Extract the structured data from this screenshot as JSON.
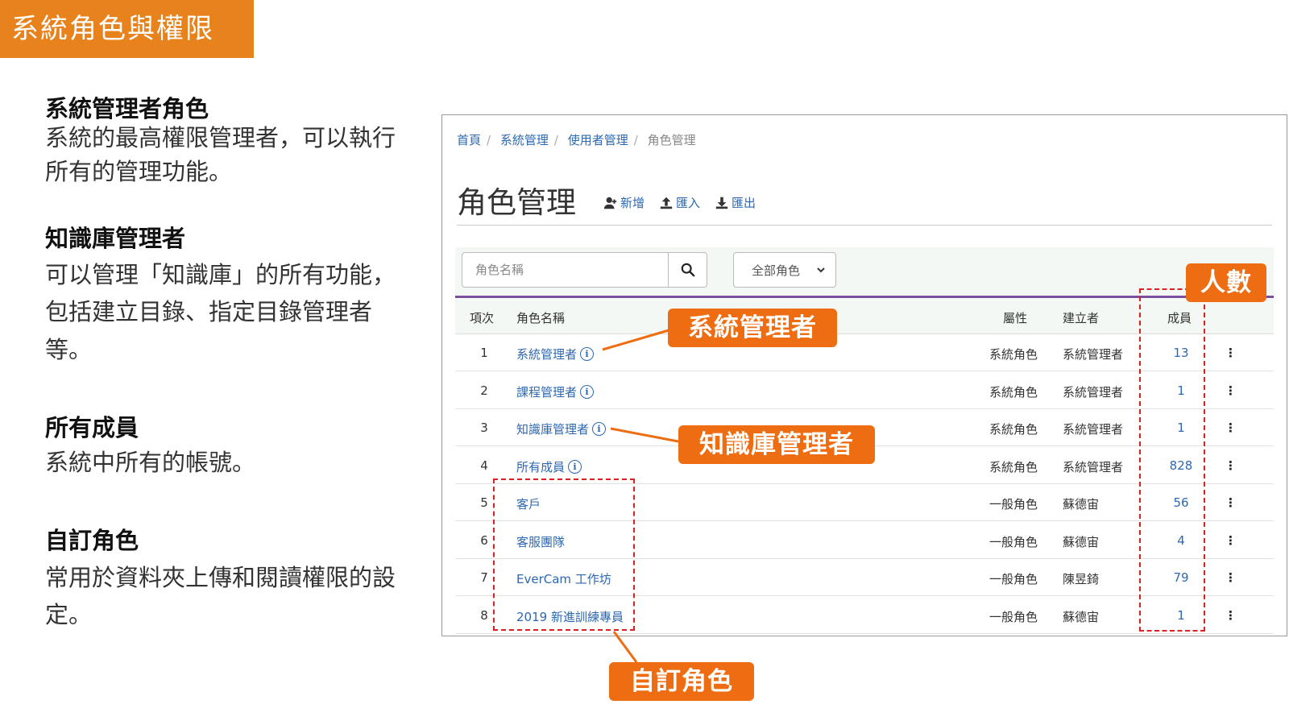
{
  "slide": {
    "title": "系統角色與權限"
  },
  "notes": [
    {
      "heading": "系統管理者角色",
      "body": "系統的最高權限管理者，可以執行所有的管理功能。"
    },
    {
      "heading": "知識庫管理者",
      "body": "可以管理「知識庫」的所有功能，包括建立目錄、指定目錄管理者等。"
    },
    {
      "heading": "所有成員",
      "body": "系統中所有的帳號。"
    },
    {
      "heading": "自訂角色",
      "body": "常用於資料夾上傳和閱讀權限的設定。"
    }
  ],
  "app": {
    "breadcrumb": [
      "首頁",
      "系統管理",
      "使用者管理",
      "角色管理"
    ],
    "page_title": "角色管理",
    "actions": {
      "add": "新增",
      "import": "匯入",
      "export": "匯出"
    },
    "search": {
      "placeholder": "角色名稱",
      "value": ""
    },
    "role_filter": {
      "selected": "全部角色"
    },
    "columns": {
      "index": "項次",
      "name": "角色名稱",
      "attribute": "屬性",
      "creator": "建立者",
      "members": "成員"
    },
    "rows": [
      {
        "index": "1",
        "name": "系統管理者",
        "info": true,
        "attribute": "系統角色",
        "creator": "系統管理者",
        "members": "13"
      },
      {
        "index": "2",
        "name": "課程管理者",
        "info": true,
        "attribute": "系統角色",
        "creator": "系統管理者",
        "members": "1"
      },
      {
        "index": "3",
        "name": "知識庫管理者",
        "info": true,
        "attribute": "系統角色",
        "creator": "系統管理者",
        "members": "1"
      },
      {
        "index": "4",
        "name": "所有成員",
        "info": true,
        "attribute": "系統角色",
        "creator": "系統管理者",
        "members": "828"
      },
      {
        "index": "5",
        "name": "客戶",
        "info": false,
        "attribute": "一般角色",
        "creator": "蘇德宙",
        "members": "56"
      },
      {
        "index": "6",
        "name": "客服團隊",
        "info": false,
        "attribute": "一般角色",
        "creator": "蘇德宙",
        "members": "4"
      },
      {
        "index": "7",
        "name": "EverCam 工作坊",
        "info": false,
        "attribute": "一般角色",
        "creator": "陳昱錡",
        "members": "79"
      },
      {
        "index": "8",
        "name": "2019 新進訓練專員",
        "info": false,
        "attribute": "一般角色",
        "creator": "蘇德宙",
        "members": "1"
      }
    ],
    "row_menu_glyph": "⋮",
    "info_glyph": "i"
  },
  "callouts": {
    "system_admin": "系統管理者",
    "kb_admin": "知識庫管理者",
    "custom_role": "自訂角色",
    "member_count": "人數"
  },
  "colors": {
    "title_bar": "#e8821c",
    "callout": "#ee6c12",
    "link": "#2d68b0",
    "tab_underline": "#7a4fa0",
    "dashed_box": "#e02020"
  },
  "icons": {
    "add": "user-plus-icon",
    "import": "upload-icon",
    "export": "download-icon",
    "search": "search-icon",
    "select_caret": "chevron-down-icon",
    "row_menu": "kebab-menu-icon",
    "role_info": "info-icon"
  }
}
